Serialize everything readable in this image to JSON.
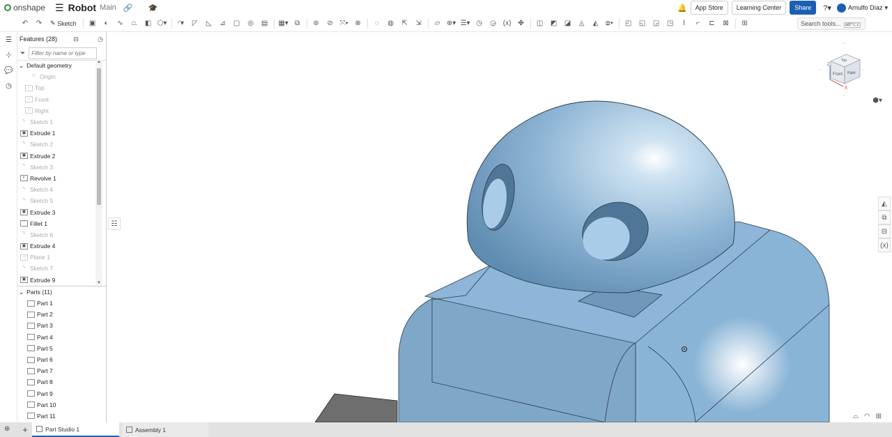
{
  "app": {
    "name": "onshape"
  },
  "document": {
    "title": "Robot",
    "branch": "Main"
  },
  "topbar": {
    "app_store": "App Store",
    "learning_center": "Learning Center",
    "share": "Share",
    "user": "Arnulfo Díaz"
  },
  "toolbar": {
    "sketch_label": "Sketch",
    "search_placeholder": "Search tools...",
    "search_shortcut": "alt/⌥ c"
  },
  "features": {
    "title": "Features (28)",
    "filter_placeholder": "Filter by name or type",
    "default_geometry": "Default geometry",
    "items": [
      {
        "label": "Origin",
        "icon": "origin-icon",
        "state": "grey",
        "indent": 2
      },
      {
        "label": "Top",
        "icon": "plane-icon",
        "state": "grey",
        "indent": 1
      },
      {
        "label": "Front",
        "icon": "plane-icon",
        "state": "grey",
        "indent": 1
      },
      {
        "label": "Right",
        "icon": "plane-icon",
        "state": "grey",
        "indent": 1
      },
      {
        "label": "Sketch 1",
        "icon": "sketch-icon",
        "state": "grey",
        "indent": 0
      },
      {
        "label": "Extrude 1",
        "icon": "extrude-icon",
        "state": "normal",
        "indent": 0
      },
      {
        "label": "Sketch 2",
        "icon": "sketch-icon",
        "state": "grey",
        "indent": 0
      },
      {
        "label": "Extrude 2",
        "icon": "extrude-icon",
        "state": "normal",
        "indent": 0
      },
      {
        "label": "Sketch 3",
        "icon": "sketch-icon",
        "state": "grey",
        "indent": 0
      },
      {
        "label": "Revolve 1",
        "icon": "revolve-icon",
        "state": "normal",
        "indent": 0
      },
      {
        "label": "Sketch 4",
        "icon": "sketch-icon",
        "state": "grey",
        "indent": 0
      },
      {
        "label": "Sketch 5",
        "icon": "sketch-icon",
        "state": "grey",
        "indent": 0
      },
      {
        "label": "Extrude 3",
        "icon": "extrude-icon",
        "state": "normal",
        "indent": 0
      },
      {
        "label": "Fillet 1",
        "icon": "fillet-icon",
        "state": "normal",
        "indent": 0
      },
      {
        "label": "Sketch 6",
        "icon": "sketch-icon",
        "state": "grey",
        "indent": 0
      },
      {
        "label": "Extrude 4",
        "icon": "extrude-icon",
        "state": "normal",
        "indent": 0
      },
      {
        "label": "Plane 1",
        "icon": "plane-icon",
        "state": "grey",
        "indent": 0
      },
      {
        "label": "Sketch 7",
        "icon": "sketch-icon",
        "state": "grey",
        "indent": 0
      },
      {
        "label": "Extrude 9",
        "icon": "extrude-icon",
        "state": "normal",
        "indent": 0
      }
    ]
  },
  "parts": {
    "title": "Parts (11)",
    "items": [
      "Part 1",
      "Part 2",
      "Part 3",
      "Part 4",
      "Part 5",
      "Part 6",
      "Part 7",
      "Part 8",
      "Part 9",
      "Part 10",
      "Part 11"
    ]
  },
  "tabs": [
    {
      "label": "Part Studio 1",
      "active": true
    },
    {
      "label": "Assembly 1",
      "active": false
    }
  ],
  "viewcube": {
    "top": "Top",
    "front": "Front",
    "right": "Right",
    "x": "X",
    "z": "Z"
  },
  "colors": {
    "accent": "#1b5fb4",
    "model": "#8fb6d6",
    "model_dark": "#5c87a8",
    "edge": "#2b3a48"
  }
}
